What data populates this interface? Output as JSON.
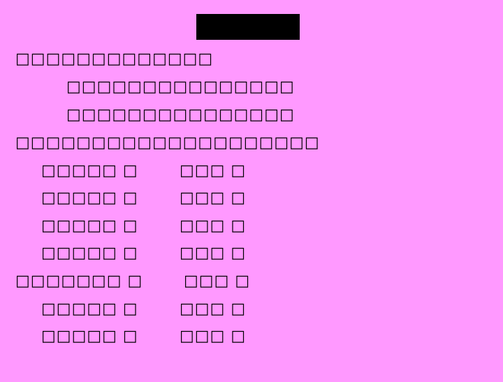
{
  "slide": {
    "title": "",
    "background_color": "#ff99ff",
    "lines": [
      "□□□□□□□□□□□□□",
      "□□□□□□□□□□□□□□□",
      "□□□□□□□□□□□□□□□",
      "□□□□□□□□□□□□□□□□□□□□"
    ],
    "rows": [
      {
        "label": "□□□□□ □",
        "value": "□□□ □"
      },
      {
        "label": "□□□□□ □",
        "value": "□□□ □"
      },
      {
        "label": "□□□□□ □",
        "value": "□□□ □"
      },
      {
        "label": "□□□□□ □",
        "value": "□□□ □"
      },
      {
        "label": "□□□□□□□ □",
        "value": "□□□ □"
      },
      {
        "label": "□□□□□ □",
        "value": "□□□ □"
      },
      {
        "label": "□□□□□ □",
        "value": "□□□ □"
      }
    ]
  }
}
